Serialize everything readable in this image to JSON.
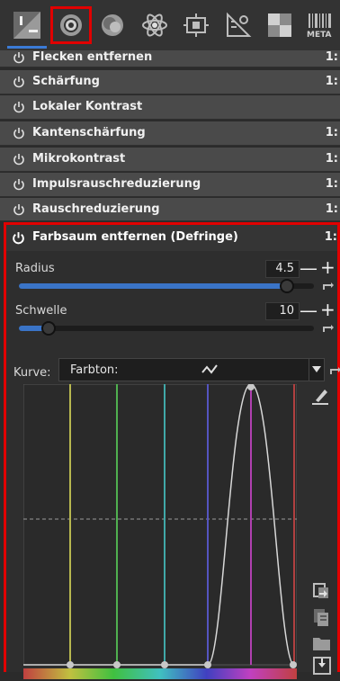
{
  "toolbar": {
    "tools": [
      {
        "name": "exposure-tab",
        "icon": "exposure-icon"
      },
      {
        "name": "detail-tab",
        "icon": "detail-icon",
        "highlighted": true
      },
      {
        "name": "color-tab",
        "icon": "color-icon"
      },
      {
        "name": "advanced-tab",
        "icon": "atom-icon"
      },
      {
        "name": "transform-tab",
        "icon": "transform-icon"
      },
      {
        "name": "raw-tab",
        "icon": "raw-icon"
      },
      {
        "name": "filmstrip-tab",
        "icon": "checkerboard-icon"
      },
      {
        "name": "meta-tab",
        "icon": "meta-icon",
        "label": "META"
      }
    ]
  },
  "modules": [
    {
      "label": "Flecken entfernen",
      "version": "1:"
    },
    {
      "label": "Schärfung",
      "version": "1:"
    },
    {
      "label": "Lokaler Kontrast",
      "version": ""
    },
    {
      "label": "Kantenschärfung",
      "version": "1:"
    },
    {
      "label": "Mikrokontrast",
      "version": "1:"
    },
    {
      "label": "Impulsrauschreduzierung",
      "version": "1:"
    },
    {
      "label": "Rauschreduzierung",
      "version": "1:"
    }
  ],
  "defringe": {
    "title": "Farbsaum entfernen (Defringe)",
    "version": "1:",
    "radius": {
      "label": "Radius",
      "value": "4.5",
      "fraction": 0.91
    },
    "schwelle": {
      "label": "Schwelle",
      "value": "10",
      "fraction": 0.1
    },
    "kurve": {
      "label": "Kurve:",
      "selected": "Farbton:"
    },
    "minus": "—",
    "plus": "+"
  },
  "colors": {
    "accent": "#3a74c7",
    "highlight": "#e10000"
  }
}
